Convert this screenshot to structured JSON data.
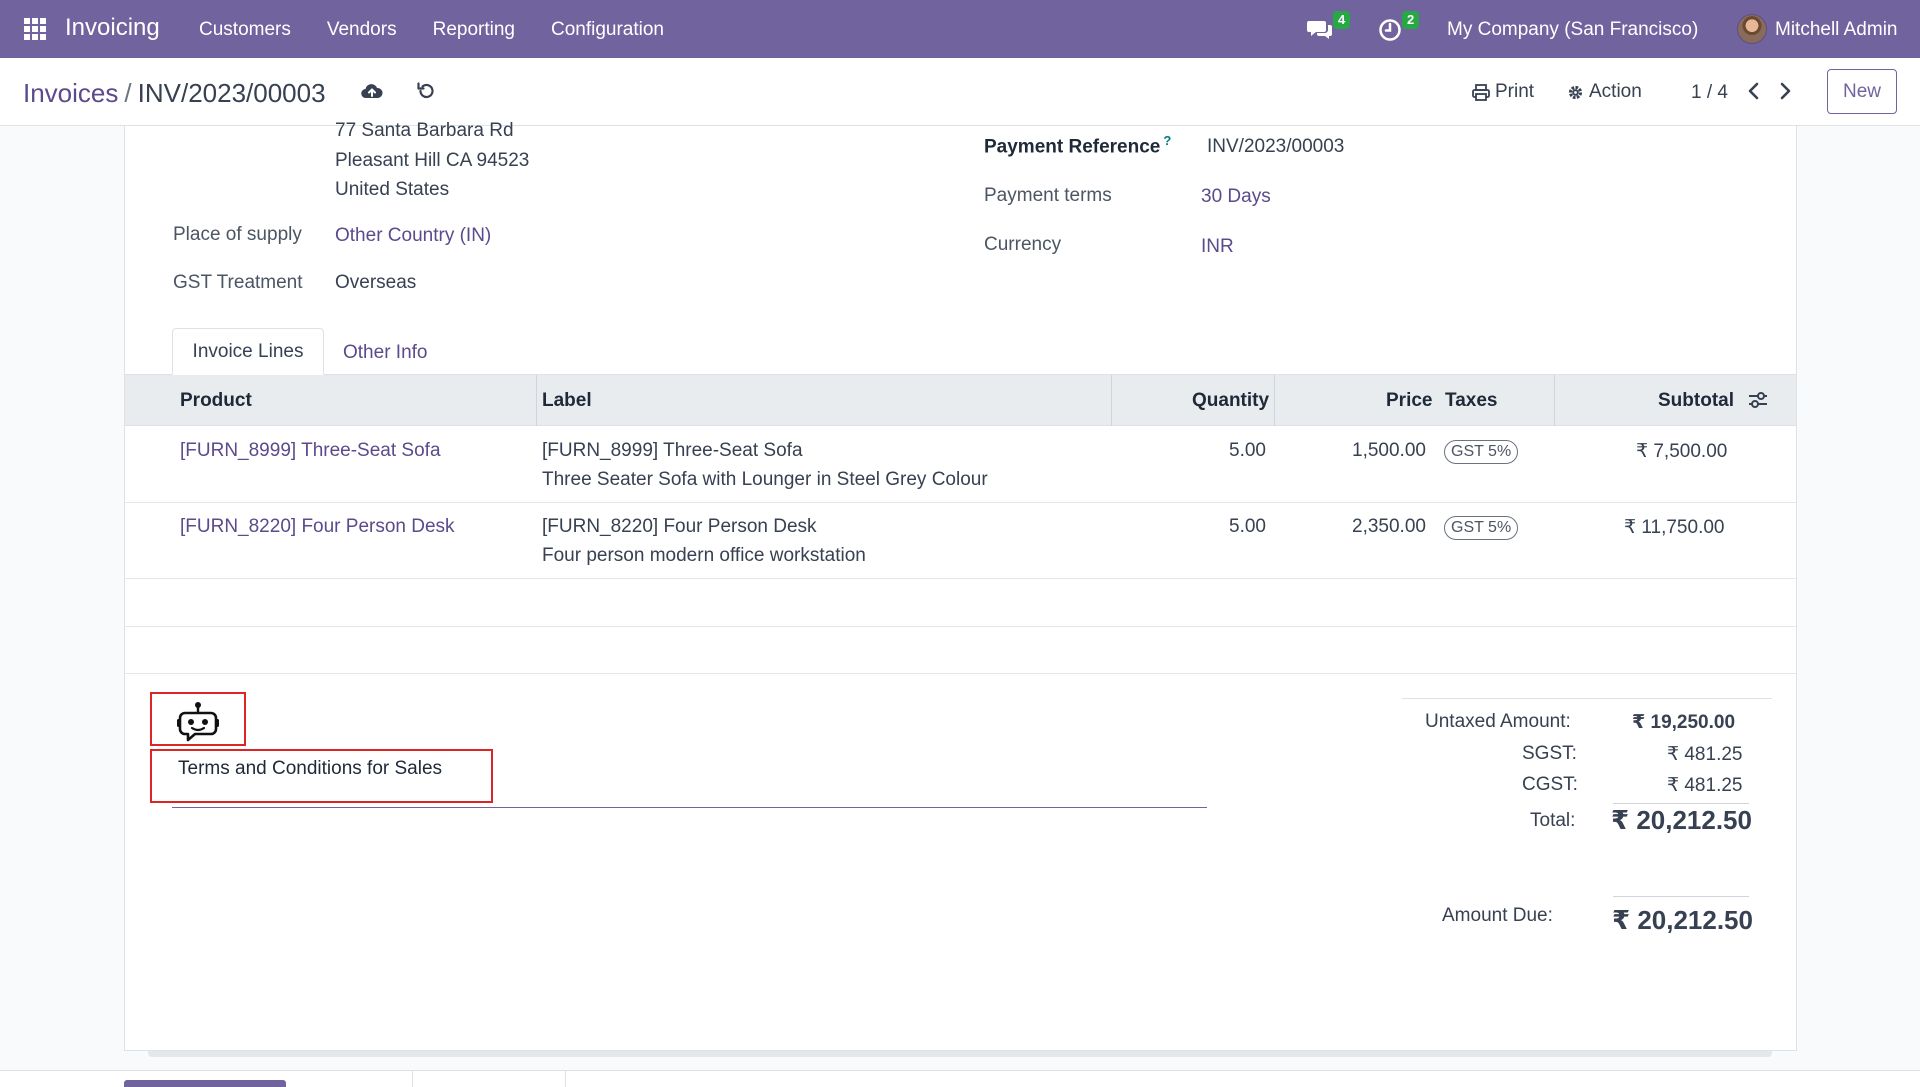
{
  "nav": {
    "app_name": "Invoicing",
    "menu": [
      "Customers",
      "Vendors",
      "Reporting",
      "Configuration"
    ],
    "messages_count": "4",
    "activities_count": "2",
    "company": "My Company (San Francisco)",
    "user": "Mitchell Admin"
  },
  "control": {
    "breadcrumb_parent": "Invoices",
    "breadcrumb_sep": "/",
    "breadcrumb_current": "INV/2023/00003",
    "print_label": "Print",
    "action_label": "Action",
    "pager": "1 / 4",
    "new_label": "New"
  },
  "customer": {
    "address_line1": "77 Santa Barbara Rd",
    "address_line2": "Pleasant Hill CA 94523",
    "address_line3": "United States",
    "place_of_supply_label": "Place of supply",
    "place_of_supply": "Other Country (IN)",
    "gst_treatment_label": "GST Treatment",
    "gst_treatment": "Overseas"
  },
  "payment": {
    "reference_label": "Payment Reference",
    "reference_help": "?",
    "reference": "INV/2023/00003",
    "terms_label": "Payment terms",
    "terms": "30 Days",
    "currency_label": "Currency",
    "currency": "INR"
  },
  "tabs": [
    "Invoice Lines",
    "Other Info"
  ],
  "table": {
    "headers": {
      "product": "Product",
      "label": "Label",
      "quantity": "Quantity",
      "price": "Price",
      "taxes": "Taxes",
      "subtotal": "Subtotal"
    },
    "rows": [
      {
        "product": "[FURN_8999] Three-Seat Sofa",
        "label_line1": "[FURN_8999] Three-Seat Sofa",
        "label_line2": "Three Seater Sofa with Lounger in Steel Grey Colour",
        "quantity": "5.00",
        "price": "1,500.00",
        "tax": "GST 5%",
        "subtotal": "₹ 7,500.00"
      },
      {
        "product": "[FURN_8220] Four Person Desk",
        "label_line1": "[FURN_8220] Four Person Desk",
        "label_line2": "Four person modern office workstation",
        "quantity": "5.00",
        "price": "2,350.00",
        "tax": "GST 5%",
        "subtotal": "₹ 11,750.00"
      }
    ]
  },
  "terms_text": "Terms and Conditions for Sales",
  "totals": {
    "untaxed_label": "Untaxed Amount:",
    "untaxed": "₹ 19,250.00",
    "sgst_label": "SGST:",
    "sgst": "₹ 481.25",
    "cgst_label": "CGST:",
    "cgst": "₹ 481.25",
    "total_label": "Total:",
    "total": "₹ 20,212.50",
    "amount_due_label": "Amount Due:",
    "amount_due": "₹ 20,212.50"
  },
  "colors": {
    "brand": "#71639e",
    "link": "#5b4a8c",
    "badge": "#28a745",
    "highlight": "#dc2626"
  }
}
